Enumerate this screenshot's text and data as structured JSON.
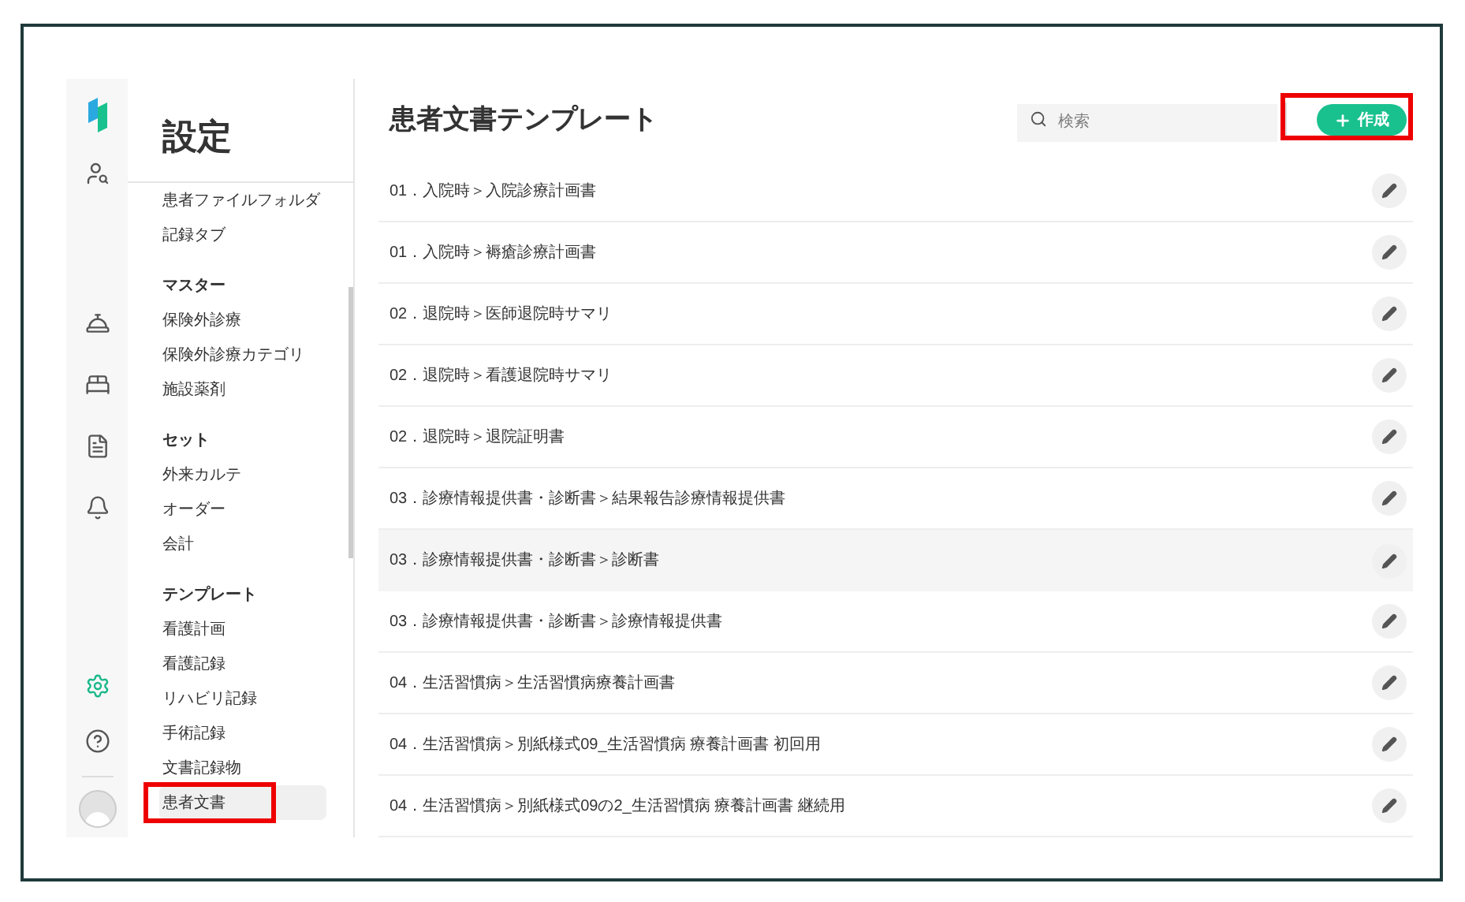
{
  "rail": {
    "items": [
      {
        "kind": "user-search",
        "selected": false
      },
      {
        "kind": "service",
        "selected": false
      },
      {
        "kind": "bed",
        "selected": false
      },
      {
        "kind": "list",
        "selected": false
      },
      {
        "kind": "bell",
        "selected": false
      },
      {
        "kind": "gear",
        "selected": true
      },
      {
        "kind": "help",
        "selected": false
      }
    ]
  },
  "sidebar": {
    "title": "設定",
    "groups": [
      {
        "items": [
          {
            "label": "患者ファイルフォルダ",
            "selected": false
          },
          {
            "label": "記録タブ",
            "selected": false
          }
        ]
      },
      {
        "heading": "マスター",
        "items": [
          {
            "label": "保険外診療",
            "selected": false
          },
          {
            "label": "保険外診療カテゴリ",
            "selected": false
          },
          {
            "label": "施設薬剤",
            "selected": false
          }
        ]
      },
      {
        "heading": "セット",
        "items": [
          {
            "label": "外来カルテ",
            "selected": false
          },
          {
            "label": "オーダー",
            "selected": false
          },
          {
            "label": "会計",
            "selected": false
          }
        ]
      },
      {
        "heading": "テンプレート",
        "items": [
          {
            "label": "看護計画",
            "selected": false
          },
          {
            "label": "看護記録",
            "selected": false
          },
          {
            "label": "リハビリ記録",
            "selected": false
          },
          {
            "label": "手術記録",
            "selected": false
          },
          {
            "label": "文書記録物",
            "selected": false
          },
          {
            "label": "患者文書",
            "selected": true,
            "annotated": true
          }
        ]
      }
    ]
  },
  "main": {
    "title": "患者文書テンプレート",
    "search": {
      "placeholder": "検索"
    },
    "create_button": {
      "label": "作成",
      "annotated": true
    },
    "rows": [
      {
        "label": "01．入院時＞入院診療計画書",
        "hovered": false
      },
      {
        "label": "01．入院時＞褥瘡診療計画書",
        "hovered": false
      },
      {
        "label": "02．退院時＞医師退院時サマリ",
        "hovered": false
      },
      {
        "label": "02．退院時＞看護退院時サマリ",
        "hovered": false
      },
      {
        "label": "02．退院時＞退院証明書",
        "hovered": false
      },
      {
        "label": "03．診療情報提供書・診断書＞結果報告診療情報提供書",
        "hovered": false
      },
      {
        "label": "03．診療情報提供書・診断書＞診断書",
        "hovered": true
      },
      {
        "label": "03．診療情報提供書・診断書＞診療情報提供書",
        "hovered": false
      },
      {
        "label": "04．生活習慣病＞生活習慣病療養計画書",
        "hovered": false
      },
      {
        "label": "04．生活習慣病＞別紙様式09_生活習慣病 療養計画書 初回用",
        "hovered": false
      },
      {
        "label": "04．生活習慣病＞別紙様式09の2_生活習慣病 療養計画書 継続用",
        "hovered": false
      }
    ]
  }
}
